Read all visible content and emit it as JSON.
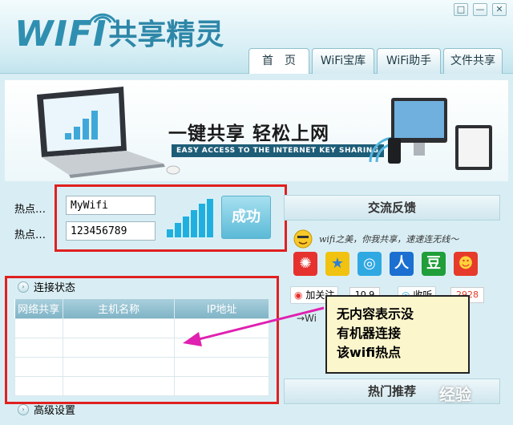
{
  "window": {
    "controls": [
      "□",
      "—",
      "✕"
    ]
  },
  "logo": {
    "wifi": "WIFI",
    "name": "共享精灵"
  },
  "tabs": [
    {
      "label": "首　页"
    },
    {
      "label": "WiFi宝库"
    },
    {
      "label": "WiFi助手"
    },
    {
      "label": "文件共享"
    }
  ],
  "banner": {
    "title": "一键共享 轻松上网",
    "subtitle": "EASY ACCESS TO THE INTERNET KEY SHARING"
  },
  "hotspot": {
    "ssid_label": "热点…",
    "ssid_value": "MyWifi",
    "password_label": "热点…",
    "password_value": "123456789",
    "status_button": "成功"
  },
  "connection": {
    "header": "连接状态",
    "columns": [
      "网络共享",
      "主机名称",
      "IP地址"
    ],
    "rows": 5
  },
  "advanced": {
    "header": "高级设置"
  },
  "feedback": {
    "header": "交流反馈",
    "slogan": "wifi之美，你我共享，速速连无线～",
    "follow_label": "加关注",
    "follow_count": "10.9",
    "listen_label": "收听",
    "listen_count": "2928",
    "arrow_text": "→Wi"
  },
  "hot_recommend": {
    "header": "热门推荐"
  },
  "annotation": {
    "lines": [
      "无内容表示没",
      "有机器连接",
      "该wifi热点"
    ]
  },
  "watermark": "经验",
  "colors": {
    "highlight_box": "#e02020",
    "arrow": "#e020b0",
    "callout_bg": "#fbf6cc"
  }
}
